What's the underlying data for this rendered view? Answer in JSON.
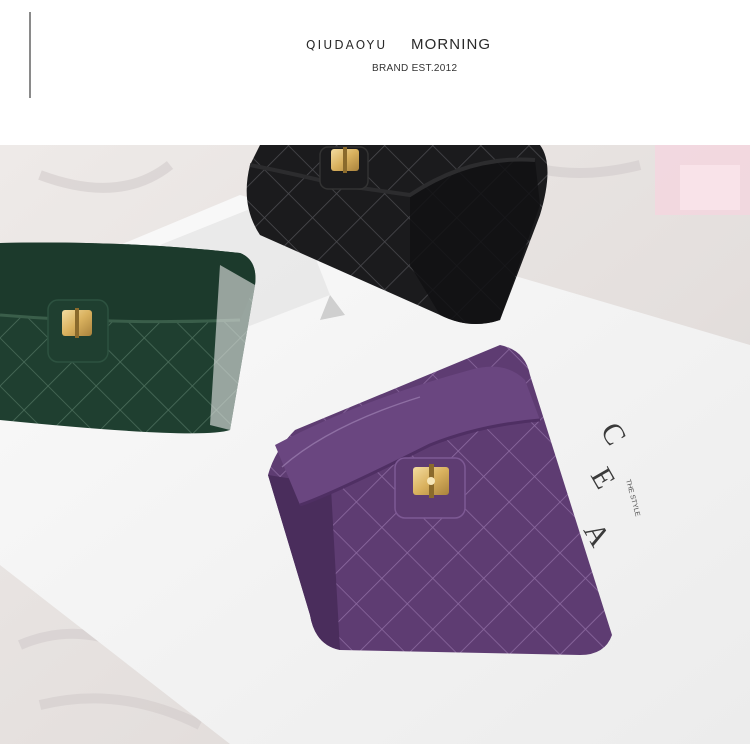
{
  "header": {
    "brand_name": "QIUDAOYU",
    "brand_tagline": "MORNING",
    "brand_sub": "BRAND EST.2012"
  },
  "photo": {
    "subject": "three quilted leather card-holder wallets with gold turn-lock clasps on white cloth and a printed card",
    "wallets": [
      {
        "color_name": "black",
        "color": "#1b1b1d"
      },
      {
        "color_name": "green",
        "color": "#1f3f30"
      },
      {
        "color_name": "purple",
        "color": "#5e3c72"
      }
    ],
    "card_text": "CEAL",
    "card_small_text": "THE STYLE",
    "accent_gold": "#d9b15e"
  }
}
